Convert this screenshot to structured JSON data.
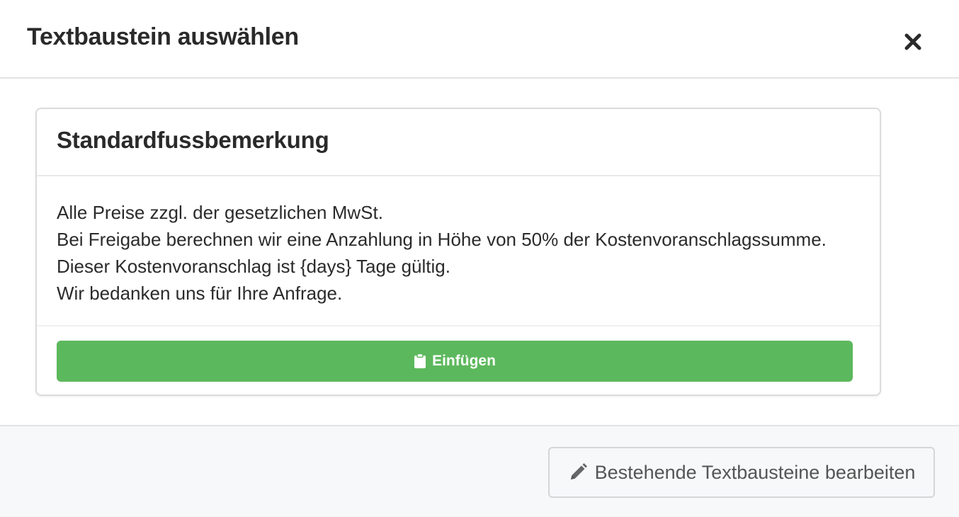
{
  "modal": {
    "title": "Textbaustein auswählen",
    "close_icon": "close-icon"
  },
  "snippet": {
    "title": "Standardfussbemerkung",
    "lines": [
      "Alle Preise zzgl. der gesetzlichen MwSt.",
      "Bei Freigabe berechnen wir eine Anzahlung in Höhe von 50% der Kostenvoranschlagssumme.",
      "Dieser Kostenvoranschlag ist {days} Tage gültig.",
      "Wir bedanken uns für Ihre Anfrage."
    ],
    "insert_label": "Einfügen",
    "insert_icon": "clipboard-icon"
  },
  "footer": {
    "edit_label": "Bestehende Textbausteine bearbeiten",
    "edit_icon": "pencil-icon"
  },
  "colors": {
    "insert_button": "#5cb85c",
    "footer_background": "#f7f8fa"
  }
}
